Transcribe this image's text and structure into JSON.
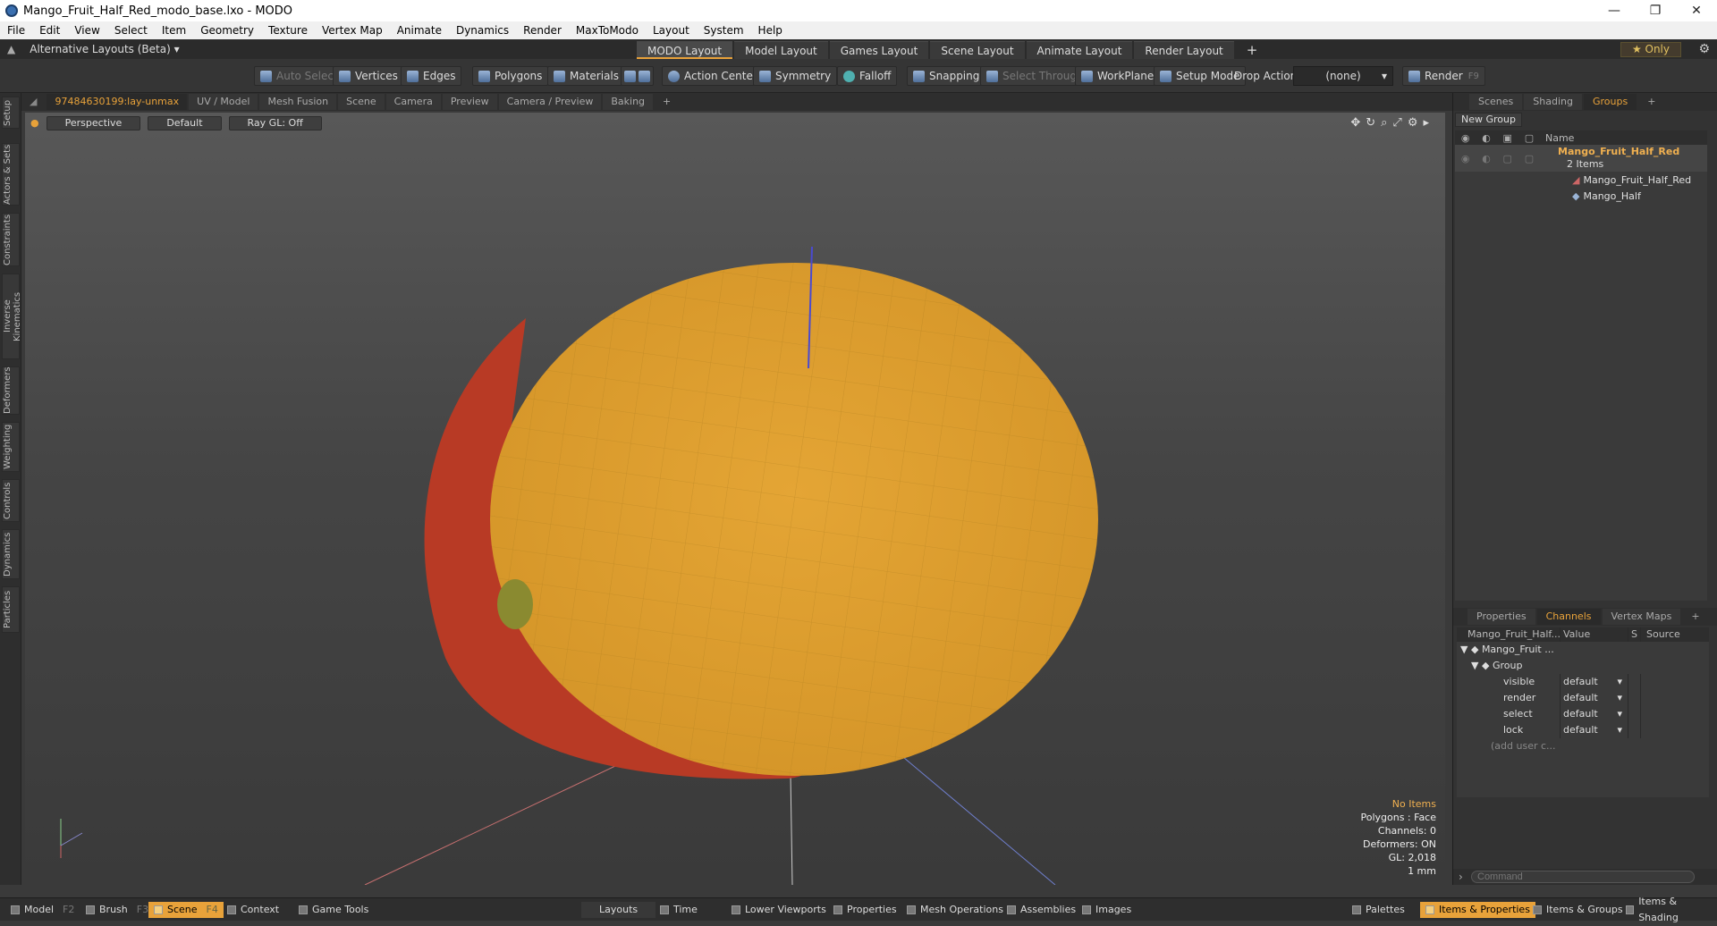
{
  "window": {
    "title": "Mango_Fruit_Half_Red_modo_base.lxo - MODO",
    "minimize": "—",
    "restore": "❐",
    "close": "✕"
  },
  "menu": [
    "File",
    "Edit",
    "View",
    "Select",
    "Item",
    "Geometry",
    "Texture",
    "Vertex Map",
    "Animate",
    "Dynamics",
    "Render",
    "MaxToModo",
    "Layout",
    "System",
    "Help"
  ],
  "layouts": {
    "alt_label": "Alternative Layouts (Beta) ▾",
    "tabs": [
      "MODO Layout",
      "Model Layout",
      "Games Layout",
      "Scene Layout",
      "Animate Layout",
      "Render Layout"
    ],
    "plus": "+",
    "only": "★ Only",
    "gear": "⚙"
  },
  "toolbar": {
    "auto_select": "Auto Select",
    "vertices": "Vertices",
    "edges": "Edges",
    "polygons": "Polygons",
    "materials": "Materials",
    "action_center": "Action Center",
    "symmetry": "Symmetry",
    "falloff": "Falloff",
    "snapping": "Snapping",
    "select_through": "Select Through",
    "workplane": "WorkPlane",
    "setup_mode": "Setup Mode",
    "drop_action": "Drop Action",
    "drop_value": "(none)",
    "render": "Render",
    "render_key": "F9"
  },
  "left_tabs": [
    "Setup",
    "Actors & Sets",
    "Constraints",
    "Inverse Kinematics",
    "Deformers",
    "Weighting",
    "Controls",
    "Dynamics",
    "Particles"
  ],
  "viewport_tabs": [
    "97484630199:lay-unmax",
    "UV / Model",
    "Mesh Fusion",
    "Scene",
    "Camera",
    "Preview",
    "Camera / Preview",
    "Baking",
    "+"
  ],
  "viewport": {
    "view": "Perspective",
    "shading": "Default",
    "raygl": "Ray GL: Off",
    "info": {
      "items": "No Items",
      "polygons": "Polygons : Face",
      "channels": "Channels: 0",
      "deformers": "Deformers: ON",
      "gl": "GL: 2,018",
      "scale": "1 mm"
    }
  },
  "groups_panel": {
    "tabs": [
      "Scenes",
      "Shading",
      "Groups",
      "+"
    ],
    "new_group": "New Group",
    "name_header": "Name",
    "group_name": "Mango_Fruit_Half_Red",
    "group_count": "2 Items",
    "items": [
      "Mango_Fruit_Half_Red",
      "Mango_Half"
    ]
  },
  "channels_panel": {
    "tabs": [
      "Properties",
      "Channels",
      "Vertex Maps",
      "+"
    ],
    "headers": {
      "name": "Mango_Fruit_Half...",
      "value": "Value",
      "s": "S",
      "source": "Source"
    },
    "root": "Mango_Fruit ...",
    "group": "Group",
    "rows": [
      {
        "name": "visible",
        "value": "default"
      },
      {
        "name": "render",
        "value": "default"
      },
      {
        "name": "select",
        "value": "default"
      },
      {
        "name": "lock",
        "value": "default"
      }
    ],
    "add_user": "(add user c...",
    "command_placeholder": "Command"
  },
  "statusbar": {
    "left": [
      {
        "label": "Model",
        "key": "F2"
      },
      {
        "label": "Brush",
        "key": "F3"
      },
      {
        "label": "Scene",
        "key": "F4"
      },
      {
        "label": "Context",
        "key": ""
      },
      {
        "label": "Game Tools",
        "key": ""
      }
    ],
    "middle": [
      "Layouts",
      "Time",
      "Lower Viewports",
      "Properties",
      "Mesh Operations",
      "Assemblies",
      "Images"
    ],
    "right": [
      "Palettes",
      "Items & Properties",
      "Items & Groups",
      "Items & Shading"
    ]
  },
  "colors": {
    "accent": "#e8a23a",
    "mango_flesh": "#e0a535",
    "mango_skin": "#b83a25"
  }
}
